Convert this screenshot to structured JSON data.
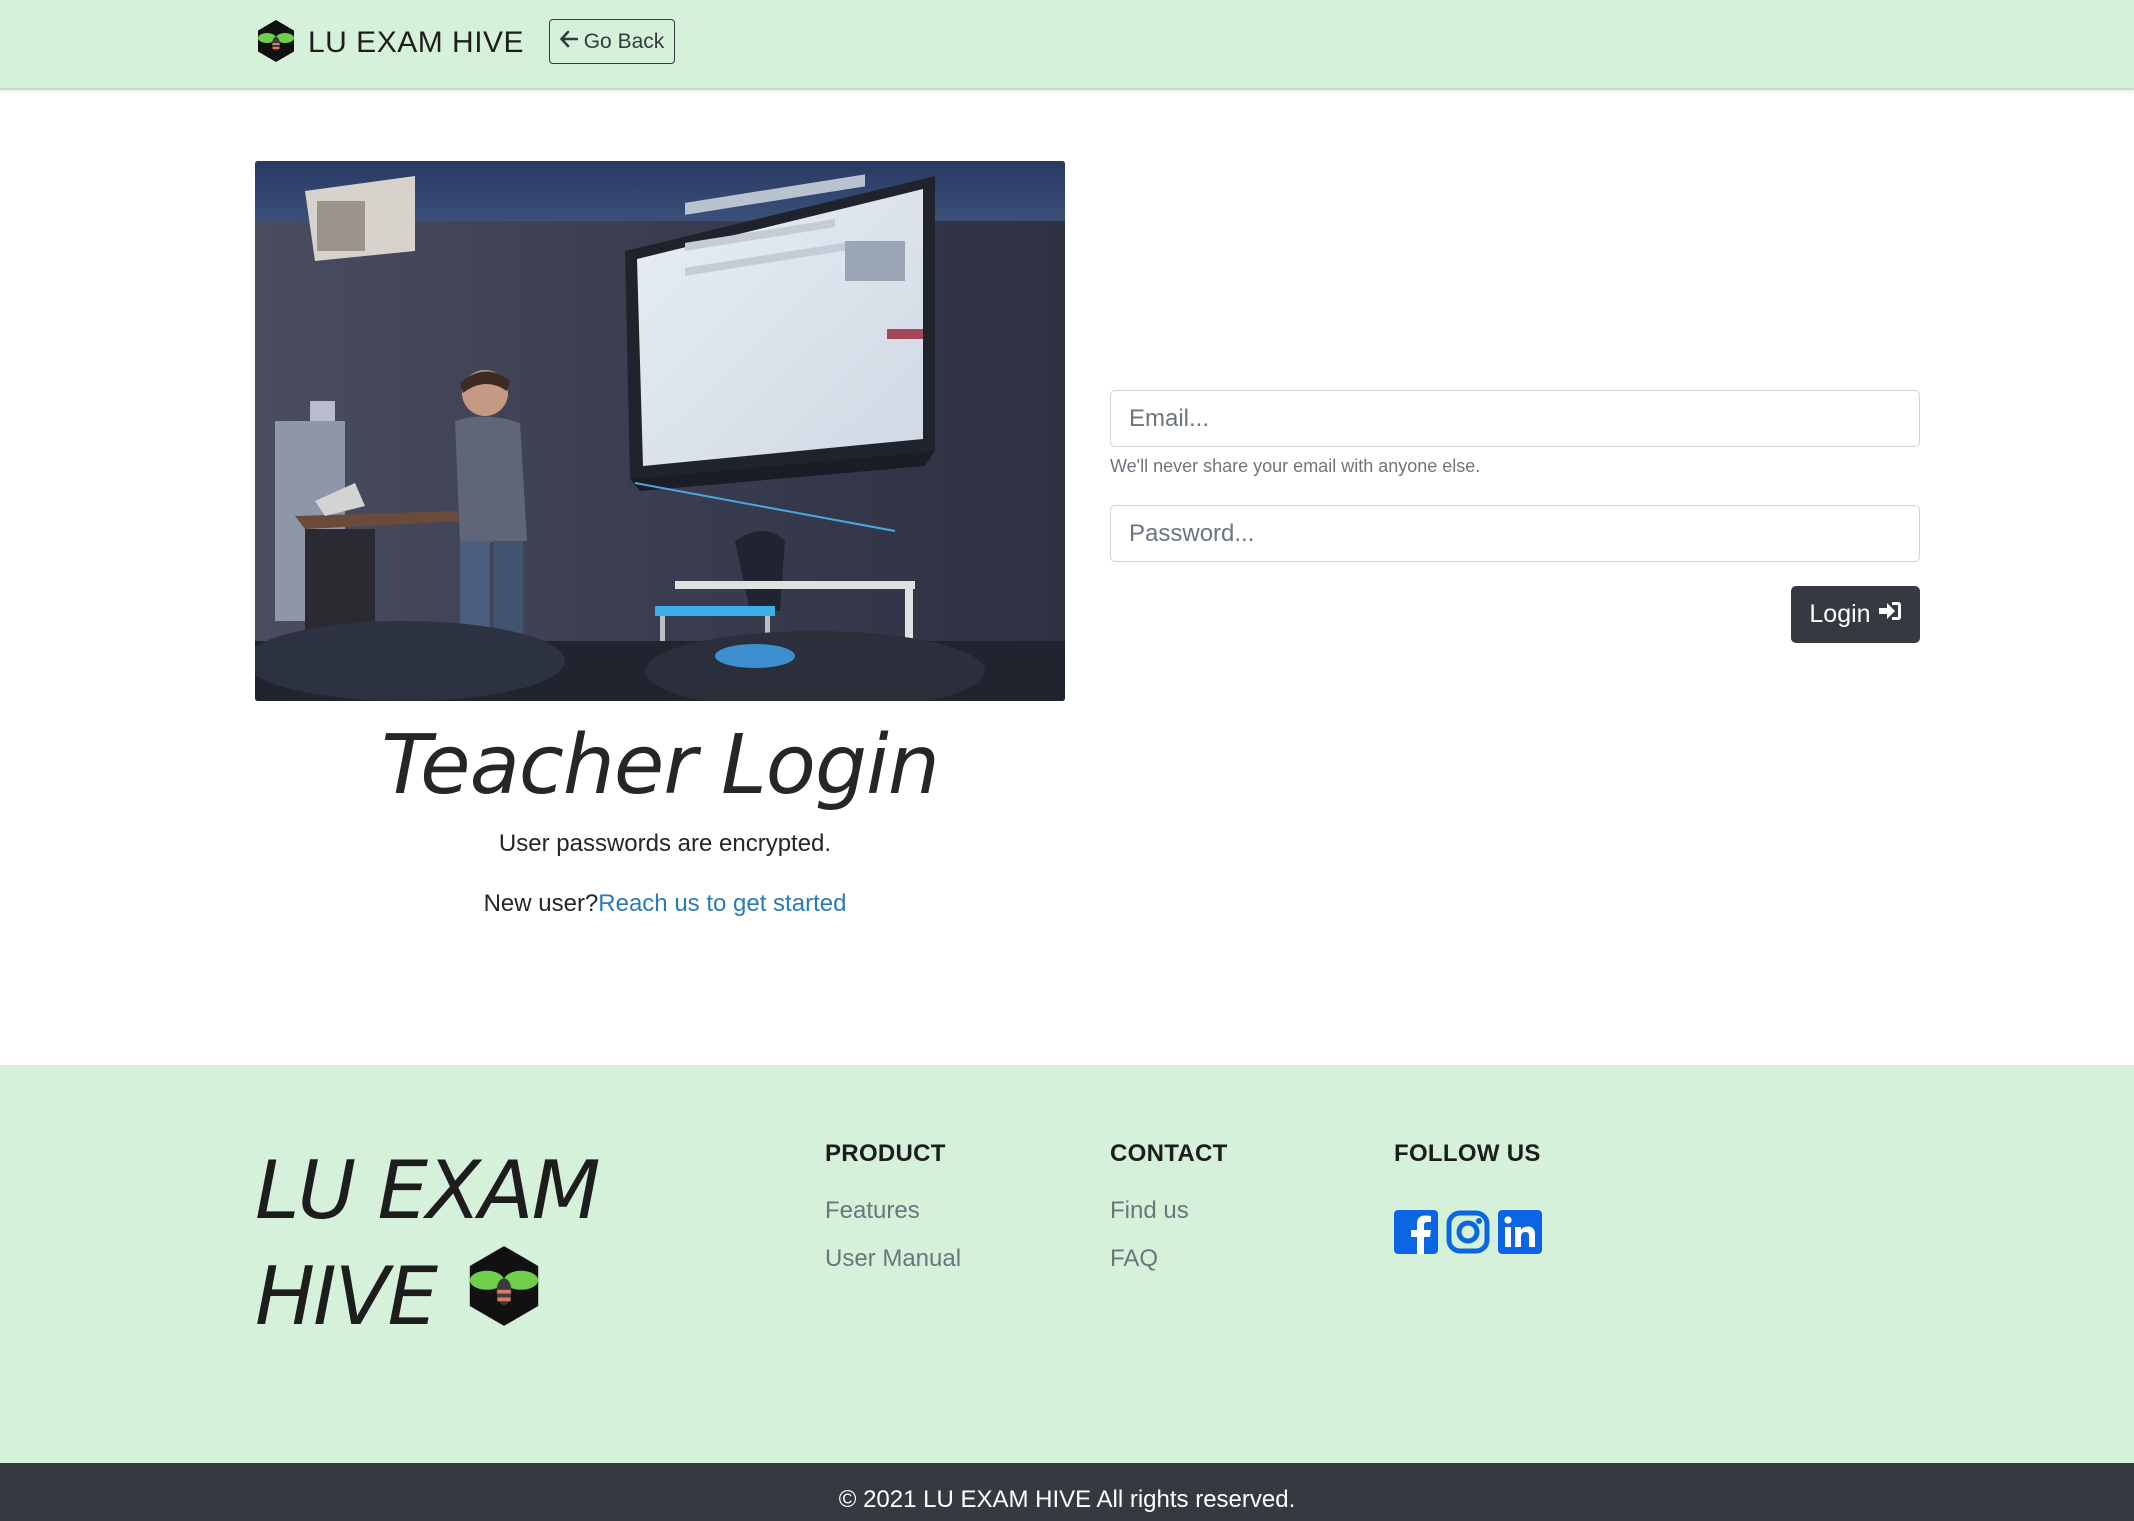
{
  "navbar": {
    "brand_text": "LU EXAM HIVE",
    "go_back_label": "Go Back"
  },
  "main": {
    "title": "Teacher Login",
    "encryption_note": "User passwords are encrypted.",
    "new_user_prefix": "New user?",
    "new_user_link": "Reach us to get started"
  },
  "form": {
    "email_placeholder": "Email...",
    "email_help": "We'll never share your email with anyone else.",
    "password_placeholder": "Password...",
    "login_label": "Login"
  },
  "footer": {
    "brand_line1": "LU EXAM",
    "brand_line2": "HIVE",
    "product": {
      "heading": "PRODUCT",
      "links": [
        "Features",
        "User Manual"
      ]
    },
    "contact": {
      "heading": "CONTACT",
      "links": [
        "Find us",
        "FAQ"
      ]
    },
    "follow": {
      "heading": "FOLLOW US",
      "icons": [
        "facebook-icon",
        "instagram-icon",
        "linkedin-icon"
      ]
    },
    "copyright": "© 2021 LU EXAM HIVE All rights reserved."
  },
  "colors": {
    "navbar_bg": "#d6f1da",
    "footer_bg": "#d6f1da",
    "dark": "#343a40",
    "link": "#2a7ab8",
    "social_blue": "#0a66e4"
  }
}
